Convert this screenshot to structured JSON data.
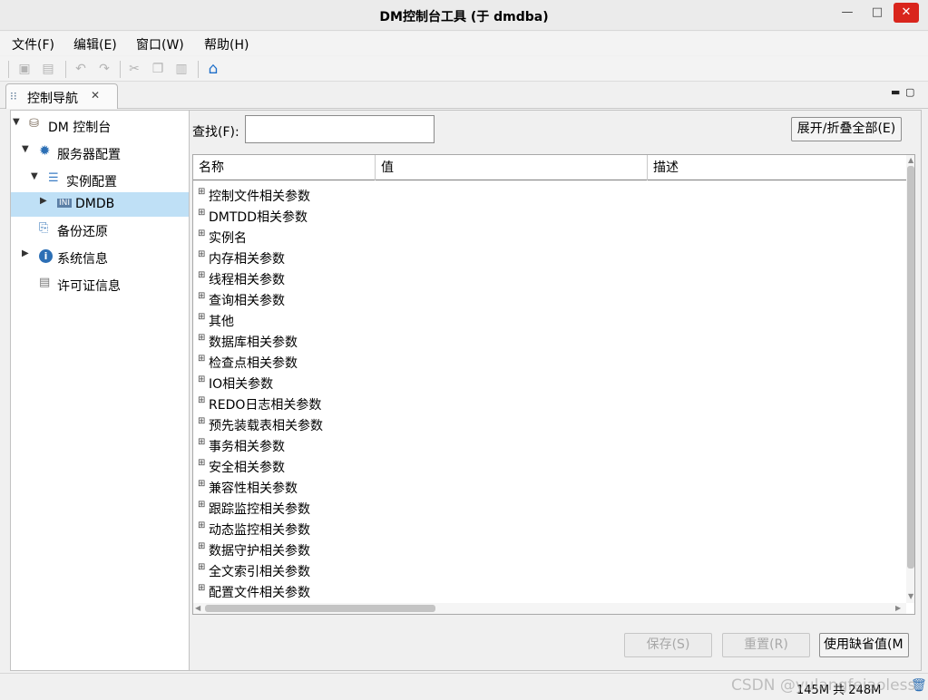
{
  "window": {
    "title": "DM控制台工具 (于 dmdba)",
    "controls": {
      "minimize": "—",
      "maximize": "□",
      "close": "✕"
    }
  },
  "menu": {
    "items": [
      "文件(F)",
      "编辑(E)",
      "窗口(W)",
      "帮助(H)"
    ]
  },
  "toolbar": {
    "icons": [
      "save-icon",
      "save-all-icon",
      "undo-icon",
      "redo-icon",
      "cut-icon",
      "copy-icon",
      "paste-icon",
      "home-icon"
    ]
  },
  "nav": {
    "tab_label": "控制导航",
    "tree": [
      {
        "label": "DM 控制台",
        "icon": "database-icon",
        "arrow": "▼",
        "selected": false
      },
      {
        "label": "服务器配置",
        "icon": "gear-icon",
        "arrow": "▼",
        "selected": false
      },
      {
        "label": "实例配置",
        "icon": "instance-icon",
        "arrow": "▼",
        "selected": false
      },
      {
        "label": "DMDB",
        "icon": "ini-file-icon",
        "arrow": "▶",
        "selected": true
      },
      {
        "label": "备份还原",
        "icon": "backup-icon",
        "arrow": "",
        "selected": false
      },
      {
        "label": "系统信息",
        "icon": "info-icon",
        "arrow": "▶",
        "selected": false
      },
      {
        "label": "许可证信息",
        "icon": "license-icon",
        "arrow": "",
        "selected": false
      }
    ]
  },
  "main": {
    "find_label": "查找(F):",
    "find_value": "",
    "expand_button": "展开/折叠全部(E)",
    "columns": [
      "名称",
      "值",
      "描述"
    ],
    "rows": [
      "控制文件相关参数",
      "DMTDD相关参数",
      "实例名",
      "内存相关参数",
      "线程相关参数",
      "查询相关参数",
      "其他",
      "数据库相关参数",
      "检查点相关参数",
      "IO相关参数",
      "REDO日志相关参数",
      "预先装载表相关参数",
      "事务相关参数",
      "安全相关参数",
      "兼容性相关参数",
      "跟踪监控相关参数",
      "动态监控相关参数",
      "数据守护相关参数",
      "全文索引相关参数",
      "配置文件相关参数"
    ],
    "buttons": {
      "save": "保存(S)",
      "reset": "重置(R)",
      "defaults": "使用缺省值(M"
    }
  },
  "status": {
    "memory": "145M 共 248M",
    "watermark": "CSDN @yulangfeiaoless"
  },
  "colors": {
    "selection": "#bfe0f6",
    "close_button": "#d9251c",
    "accent_blue": "#1e6fc9"
  }
}
